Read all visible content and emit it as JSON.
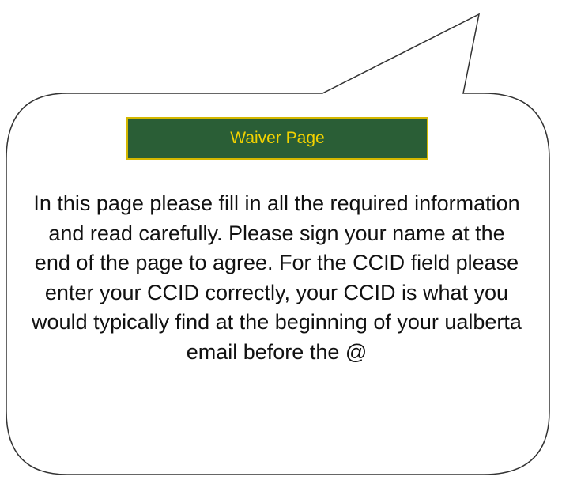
{
  "title": {
    "label": "Waiver Page",
    "background": "#2a5e36",
    "text_color": "#f2d200"
  },
  "instructions": {
    "text": "In this page please fill in all the required information and read carefully. Please sign your name at the end of the page to agree. For the CCID field please enter your CCID correctly, your CCID is what you would typically find at the beginning of your ualberta email before the @"
  },
  "bubble": {
    "fill": "#ffffff",
    "stroke": "#333333"
  }
}
